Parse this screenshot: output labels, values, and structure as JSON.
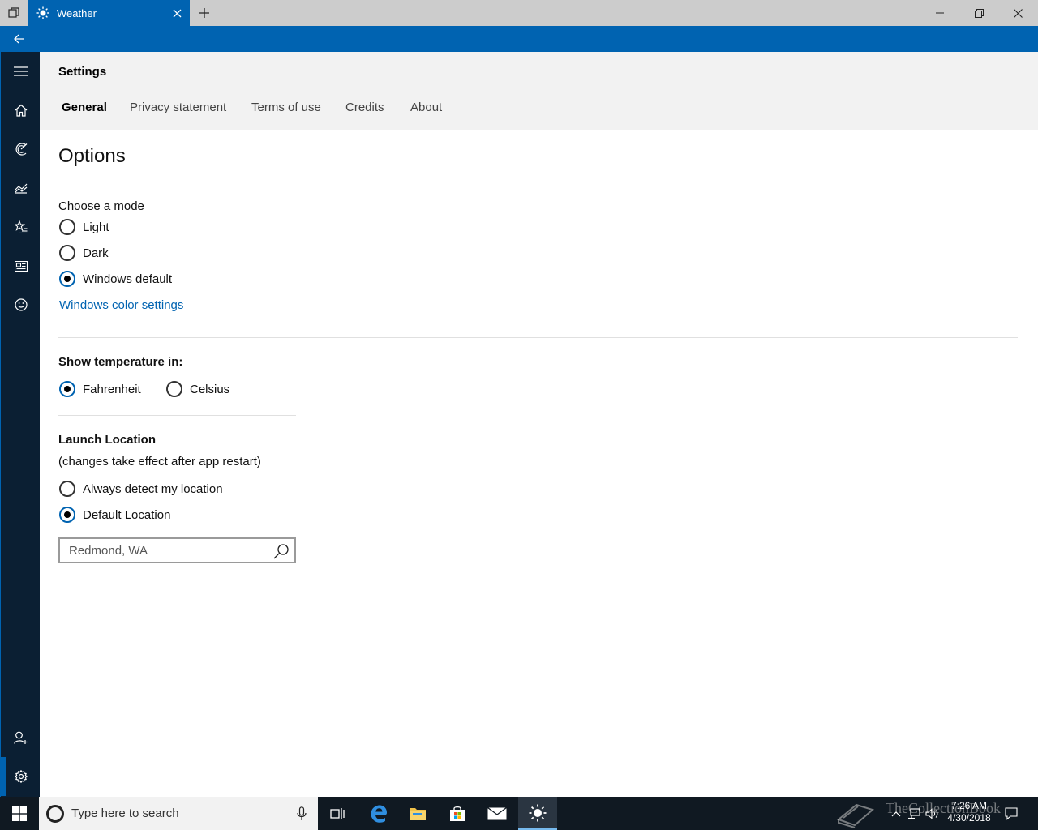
{
  "window": {
    "tab_title": "Weather"
  },
  "settings": {
    "title": "Settings",
    "tabs": [
      {
        "label": "General",
        "active": true
      },
      {
        "label": "Privacy statement",
        "active": false
      },
      {
        "label": "Terms of use",
        "active": false
      },
      {
        "label": "Credits",
        "active": false
      },
      {
        "label": "About",
        "active": false
      }
    ]
  },
  "options": {
    "heading": "Options",
    "mode": {
      "label": "Choose a mode",
      "choices": [
        {
          "label": "Light",
          "checked": false
        },
        {
          "label": "Dark",
          "checked": false
        },
        {
          "label": "Windows default",
          "checked": true
        }
      ],
      "link": "Windows color settings"
    },
    "temperature": {
      "label": "Show temperature in:",
      "choices": [
        {
          "label": "Fahrenheit",
          "checked": true
        },
        {
          "label": "Celsius",
          "checked": false
        }
      ]
    },
    "launch_location": {
      "label": "Launch Location",
      "note": "(changes take effect after app restart)",
      "choices": [
        {
          "label": "Always detect my location",
          "checked": false
        },
        {
          "label": "Default Location",
          "checked": true
        }
      ],
      "location_value": "Redmond, WA"
    }
  },
  "nav": {
    "items": [
      "hamburger-menu-icon",
      "home-icon",
      "radar-icon",
      "historical-weather-icon",
      "favorites-icon",
      "news-icon",
      "feedback-icon",
      "account-icon",
      "settings-icon"
    ],
    "selected": "settings-icon"
  },
  "taskbar": {
    "search_placeholder": "Type here to search",
    "time": "7:26 AM",
    "date": "4/30/2018",
    "apps": [
      "task-view-icon",
      "edge-icon",
      "file-explorer-icon",
      "store-icon",
      "mail-icon",
      "weather-icon"
    ],
    "active_app": "weather-icon"
  },
  "watermark": {
    "text": "TheCollectionBook"
  },
  "colors": {
    "accent": "#0063b1",
    "nav_background": "#0b1f33",
    "header_background": "#f2f2f2",
    "taskbar": "#101922"
  }
}
